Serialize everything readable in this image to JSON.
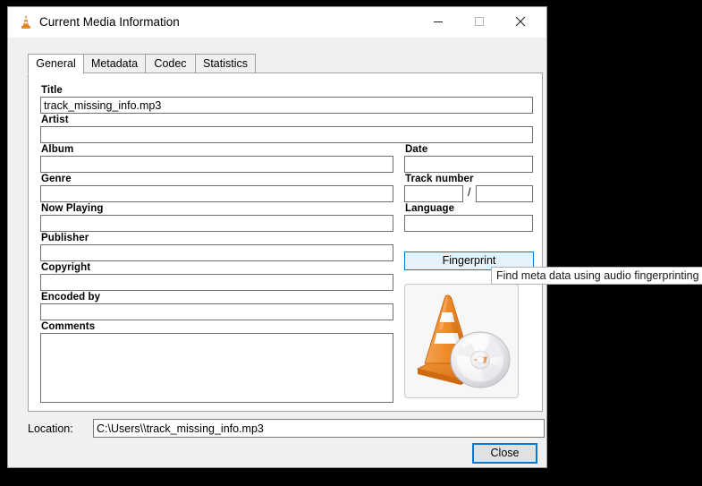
{
  "window": {
    "title": "Current Media Information",
    "icon": "vlc-cone-icon",
    "controls": {
      "minimize": "minimize-icon",
      "maximize": "maximize-icon",
      "close": "close-icon"
    }
  },
  "tabs": [
    {
      "label": "General",
      "active": true
    },
    {
      "label": "Metadata",
      "active": false
    },
    {
      "label": "Codec",
      "active": false
    },
    {
      "label": "Statistics",
      "active": false
    }
  ],
  "general": {
    "left_fields": [
      {
        "label": "Title",
        "value": "track_missing_info.mp3"
      },
      {
        "label": "Artist",
        "value": ""
      },
      {
        "label": "Album",
        "value": ""
      },
      {
        "label": "Genre",
        "value": ""
      },
      {
        "label": "Now Playing",
        "value": ""
      },
      {
        "label": "Publisher",
        "value": ""
      },
      {
        "label": "Copyright",
        "value": ""
      },
      {
        "label": "Encoded by",
        "value": ""
      }
    ],
    "comments": {
      "label": "Comments",
      "value": ""
    },
    "right_fields": [
      {
        "label": "Date",
        "value": ""
      },
      {
        "label": "Track number",
        "value": "",
        "value2": "",
        "separator": "/"
      },
      {
        "label": "Language",
        "value": ""
      }
    ],
    "fingerprint_button": "Fingerprint",
    "album_art": "vlc-cone-cd-artwork"
  },
  "tooltip": {
    "text": "Find meta data using audio fingerprinting"
  },
  "footer": {
    "location_label": "Location:",
    "location_prefix": "C:\\Users\\",
    "location_redacted": "                    ",
    "location_suffix": "\\track_missing_info.mp3",
    "close_button": "Close"
  },
  "colors": {
    "accent": "#0078d7",
    "hover_fill": "#e5f1fb",
    "dialog_bg": "#f0f0f0",
    "panel_bg": "#ffffff",
    "cone_orange": "#e8761a"
  }
}
